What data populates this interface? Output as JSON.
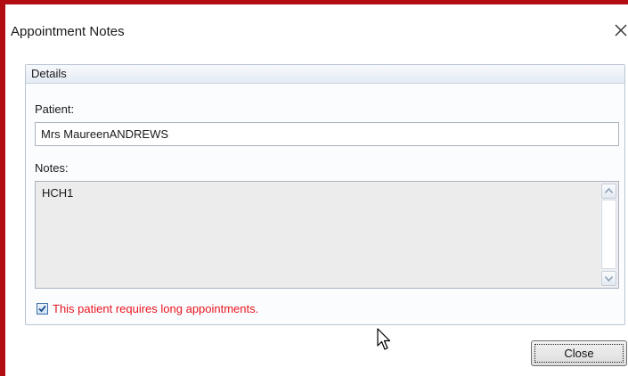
{
  "window": {
    "title": "Appointment Notes",
    "close_glyph": "✕"
  },
  "details": {
    "group_title": "Details",
    "patient_label": "Patient:",
    "patient_value": "Mrs MaureenANDREWS",
    "notes_label": "Notes:",
    "notes_value": "HCH1",
    "long_appointments_checked": true,
    "long_appointments_label": "This patient requires long appointments."
  },
  "footer": {
    "close_label": "Close"
  },
  "icons": {
    "window_close": "close-icon",
    "scroll_up": "scroll-up-arrow-icon",
    "scroll_down": "scroll-down-arrow-icon",
    "checkmark": "checkmark-icon",
    "cursor": "mouse-pointer-icon"
  },
  "colors": {
    "window_border": "#b20d12",
    "warning_text": "#e8141f"
  }
}
